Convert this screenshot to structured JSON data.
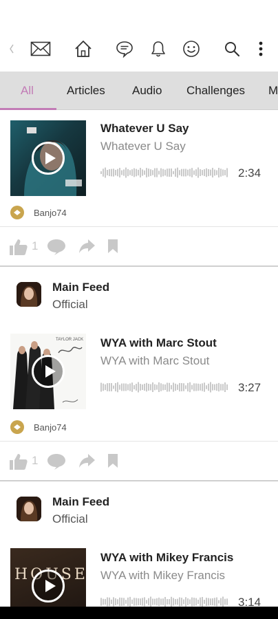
{
  "toolbar": {
    "icons": [
      "mail-icon",
      "home-icon",
      "chat-icon",
      "bell-icon",
      "smiley-icon",
      "search-icon",
      "more-vertical-icon"
    ]
  },
  "tabs": [
    "All",
    "Articles",
    "Audio",
    "Challenges",
    "M"
  ],
  "active_tab": "All",
  "colors": {
    "accent": "#c27bb6",
    "tabbar_bg": "#dedede",
    "badge": "#c9a54e",
    "icon_gray": "#c8c8c8"
  },
  "posts": [
    {
      "title": "Whatever U Say",
      "subtitle": "Whatever U Say",
      "duration": "2:34",
      "author": "Banjo74",
      "likes": "1"
    },
    {
      "feed_name": "Main Feed",
      "feed_type": "Official",
      "title": "WYA with Marc Stout",
      "subtitle": "WYA with Marc Stout",
      "duration": "3:27",
      "author": "Banjo74",
      "likes": "1",
      "cover_text": "TAYLOR JACK"
    },
    {
      "feed_name": "Main Feed",
      "feed_type": "Official",
      "title": "WYA with Mikey Francis",
      "subtitle": "WYA with Mikey Francis",
      "duration": "3:14",
      "cover_text": "HOUSE"
    }
  ]
}
